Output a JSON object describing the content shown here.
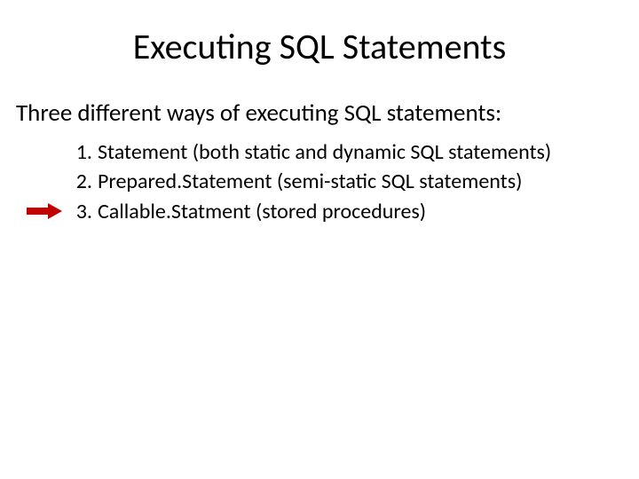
{
  "title": "Executing SQL Statements",
  "intro": "Three different ways of executing SQL statements:",
  "items": [
    {
      "num": "1.",
      "text": "Statement (both static and dynamic SQL statements)"
    },
    {
      "num": "2.",
      "text": "Prepared.Statement (semi-static SQL statements)"
    },
    {
      "num": "3.",
      "text": "Callable.Statment (stored procedures)"
    }
  ],
  "arrow_on_index": 2,
  "colors": {
    "arrow_fill": "#c00000"
  }
}
